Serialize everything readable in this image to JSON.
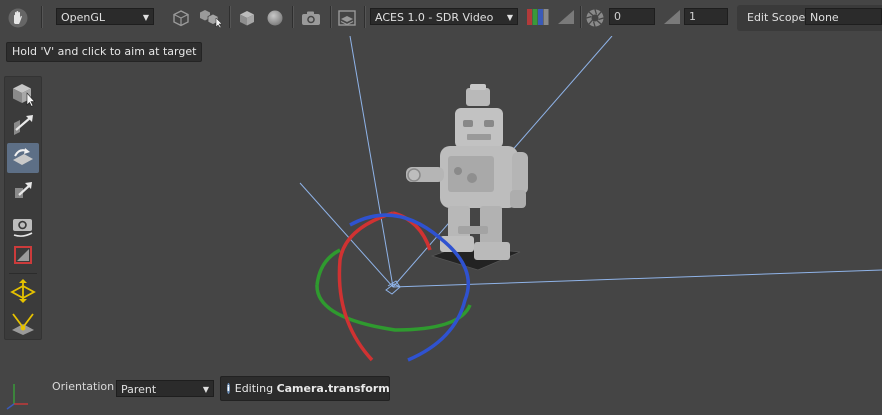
{
  "toolbar": {
    "renderer": "OpenGL",
    "color_transform": "ACES 1.0 - SDR Video",
    "exposure_value": "0",
    "gamma_value": "1",
    "edit_scope_label": "Edit Scope",
    "edit_scope_value": "None"
  },
  "tooltip": "Hold 'V' and click to aim at target",
  "bottom": {
    "orientation_label": "Orientation",
    "orientation_value": "Parent",
    "status_prefix": "Editing ",
    "status_target": "Camera.transform"
  },
  "colors": {
    "background": "#454545",
    "active_tool": "#5d6f86",
    "gizmo_x": "#d03232",
    "gizmo_y": "#2f9a2f",
    "gizmo_z": "#2f52d0",
    "camera_frustum": "#8fb3e8"
  },
  "icons": [
    "hand-icon",
    "cube-wire-icon",
    "cube-select-icon",
    "cube-solid-icon",
    "sphere-icon",
    "camera-icon",
    "image-layers-icon",
    "color-channels-icon",
    "clipping-icon",
    "aperture-icon",
    "gamma-icon",
    "select-tool-icon",
    "translate-tool-icon",
    "rotate-tool-icon",
    "scale-tool-icon",
    "camera-tool-icon",
    "crop-tool-icon",
    "clipping-plane-icon",
    "light-aim-icon",
    "axes-gizmo-icon",
    "info-icon"
  ]
}
